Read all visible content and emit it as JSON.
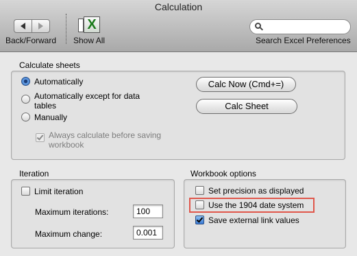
{
  "window": {
    "title": "Calculation"
  },
  "toolbar": {
    "back_forward_label": "Back/Forward",
    "show_all_label": "Show All",
    "search": {
      "placeholder": "",
      "label": "Search Excel Preferences"
    }
  },
  "calculate_sheets": {
    "title": "Calculate sheets",
    "options": [
      {
        "label": "Automatically",
        "checked": true
      },
      {
        "label": "Automatically except for data tables",
        "line1": "Automatically except for data",
        "line2": "tables",
        "checked": false
      },
      {
        "label": "Manually",
        "checked": false
      }
    ],
    "always_calculate": {
      "line1": "Always calculate before saving",
      "line2": "workbook",
      "checked": true,
      "enabled": false
    },
    "calc_now_label": "Calc Now (Cmd+=)",
    "calc_sheet_label": "Calc Sheet"
  },
  "iteration": {
    "title": "Iteration",
    "limit_label": "Limit iteration",
    "limit_checked": false,
    "max_iterations_label": "Maximum iterations:",
    "max_iterations_value": "100",
    "max_change_label": "Maximum change:",
    "max_change_value": "0.001"
  },
  "workbook_options": {
    "title": "Workbook options",
    "items": [
      {
        "label": "Set precision as displayed",
        "checked": false
      },
      {
        "label": "Use the 1904 date system",
        "checked": false,
        "highlighted": true
      },
      {
        "label": "Save external link values",
        "checked": true
      }
    ],
    "highlight_color": "#e0564a"
  }
}
